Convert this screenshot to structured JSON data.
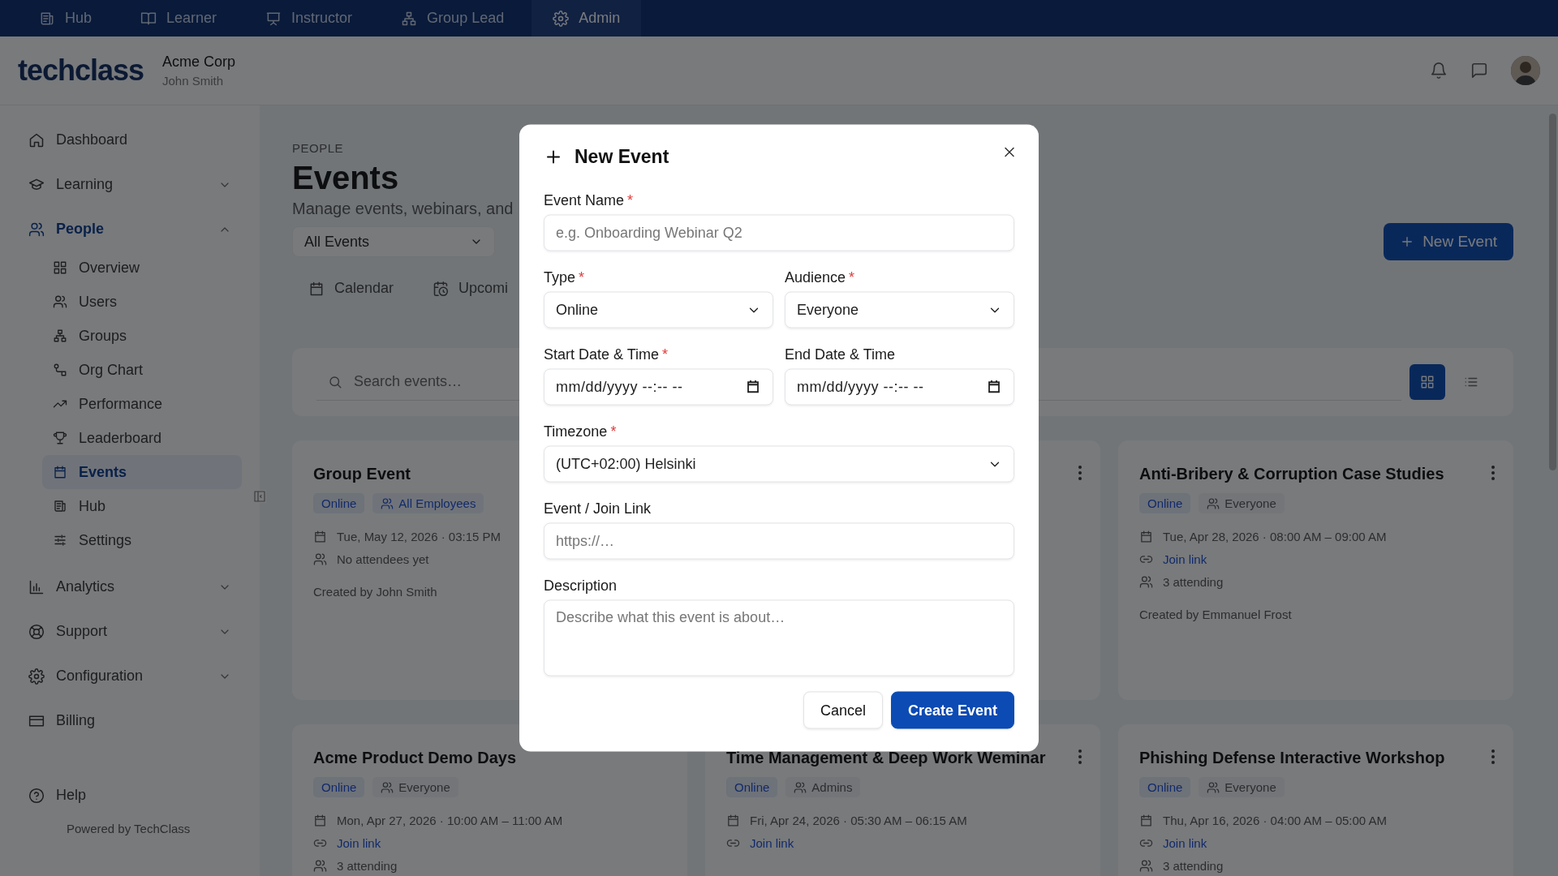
{
  "top_nav": {
    "tabs": [
      {
        "label": "Hub",
        "selected": false
      },
      {
        "label": "Learner",
        "selected": false
      },
      {
        "label": "Instructor",
        "selected": false
      },
      {
        "label": "Group Lead",
        "selected": false
      },
      {
        "label": "Admin",
        "selected": true
      }
    ]
  },
  "header": {
    "logo": "techclass",
    "org_name": "Acme Corp",
    "user_name": "John Smith"
  },
  "sidebar": {
    "items": [
      {
        "label": "Dashboard",
        "selected": false
      },
      {
        "label": "Learning",
        "selected": false,
        "expanded": false
      },
      {
        "label": "People",
        "selected": true,
        "expanded": true,
        "children": [
          {
            "label": "Overview",
            "selected": false
          },
          {
            "label": "Users",
            "selected": false
          },
          {
            "label": "Groups",
            "selected": false
          },
          {
            "label": "Org Chart",
            "selected": false
          },
          {
            "label": "Performance",
            "selected": false
          },
          {
            "label": "Leaderboard",
            "selected": false
          },
          {
            "label": "Events",
            "selected": true
          },
          {
            "label": "Hub",
            "selected": false
          },
          {
            "label": "Settings",
            "selected": false
          }
        ]
      },
      {
        "label": "Analytics",
        "selected": false,
        "expanded": false
      },
      {
        "label": "Support",
        "selected": false,
        "expanded": false
      },
      {
        "label": "Configuration",
        "selected": false,
        "expanded": false
      },
      {
        "label": "Billing",
        "selected": false
      }
    ],
    "help": "Help",
    "footer": "Powered by TechClass"
  },
  "page": {
    "breadcrumb": "PEOPLE",
    "title": "Events",
    "subtitle": "Manage events, webinars, and",
    "filter": "All Events",
    "new_button": "New Event",
    "view_tabs": [
      {
        "label": "Calendar"
      },
      {
        "label": "Upcomi"
      }
    ],
    "search": {
      "placeholder": "Search events…"
    },
    "view_toggle": [
      {
        "kind": "grid",
        "selected": true
      },
      {
        "kind": "list",
        "selected": false
      }
    ]
  },
  "cards": [
    {
      "title": "Group Event",
      "menu": false,
      "type_badge": "Online",
      "audience": {
        "label": "All Employees",
        "highlighted": true
      },
      "date": "Tue, May 12, 2026 · 03:15 PM",
      "attendees": "No attendees yet",
      "created_by": "Created by John Smith"
    },
    {
      "menu": true
    },
    {
      "title": "Anti-Bribery & Corruption Case Studies",
      "menu": true,
      "type_badge": "Online",
      "audience": {
        "label": "Everyone",
        "highlighted": false
      },
      "date": "Tue, Apr 28, 2026 · 08:00 AM – 09:00 AM",
      "link": "Join link",
      "attendees": "3 attending",
      "created_by": "Created by Emmanuel Frost"
    },
    {
      "title": "Acme Product Demo Days",
      "menu": false,
      "type_badge": "Online",
      "audience": {
        "label": "Everyone",
        "highlighted": false
      },
      "date": "Mon, Apr 27, 2026 · 10:00 AM – 11:00 AM",
      "link": "Join link",
      "attendees": "3 attending"
    },
    {
      "title": "Time Management & Deep Work Weminar",
      "menu": true,
      "type_badge": "Online",
      "audience": {
        "label": "Admins",
        "highlighted": false
      },
      "date": "Fri, Apr 24, 2026 · 05:30 AM – 06:15 AM",
      "link": "Join link"
    },
    {
      "title": "Phishing Defense Interactive Workshop",
      "menu": true,
      "type_badge": "Online",
      "audience": {
        "label": "Everyone",
        "highlighted": false
      },
      "date": "Thu, Apr 16, 2026 · 04:00 AM – 05:00 AM",
      "link": "Join link",
      "attendees": "3 attending"
    }
  ],
  "modal": {
    "title": "New Event",
    "rows": [
      [
        {
          "kind": "text",
          "label": "Event Name",
          "required_mark": "*",
          "placeholder": "e.g. Onboarding Webinar Q2"
        }
      ],
      [
        {
          "kind": "select",
          "label": "Type",
          "required_mark": "*",
          "value": "Online"
        },
        {
          "kind": "select",
          "label": "Audience",
          "required_mark": "*",
          "value": "Everyone"
        }
      ],
      [
        {
          "kind": "datetime",
          "label": "Start Date & Time",
          "required_mark": "*",
          "placeholder": "mm/dd/yyyy --:-- --"
        },
        {
          "kind": "datetime",
          "label": "End Date & Time",
          "placeholder": "mm/dd/yyyy --:-- --"
        }
      ],
      [
        {
          "kind": "select",
          "label": "Timezone",
          "required_mark": "*",
          "value": "(UTC+02:00) Helsinki"
        }
      ],
      [
        {
          "kind": "text",
          "label": "Event / Join Link",
          "placeholder": "https://…"
        }
      ],
      [
        {
          "kind": "textarea",
          "label": "Description",
          "placeholder": "Describe what this event is about…"
        }
      ]
    ],
    "buttons": [
      {
        "label": "Cancel",
        "kind": "secondary"
      },
      {
        "label": "Create Event",
        "kind": "primary"
      }
    ]
  }
}
